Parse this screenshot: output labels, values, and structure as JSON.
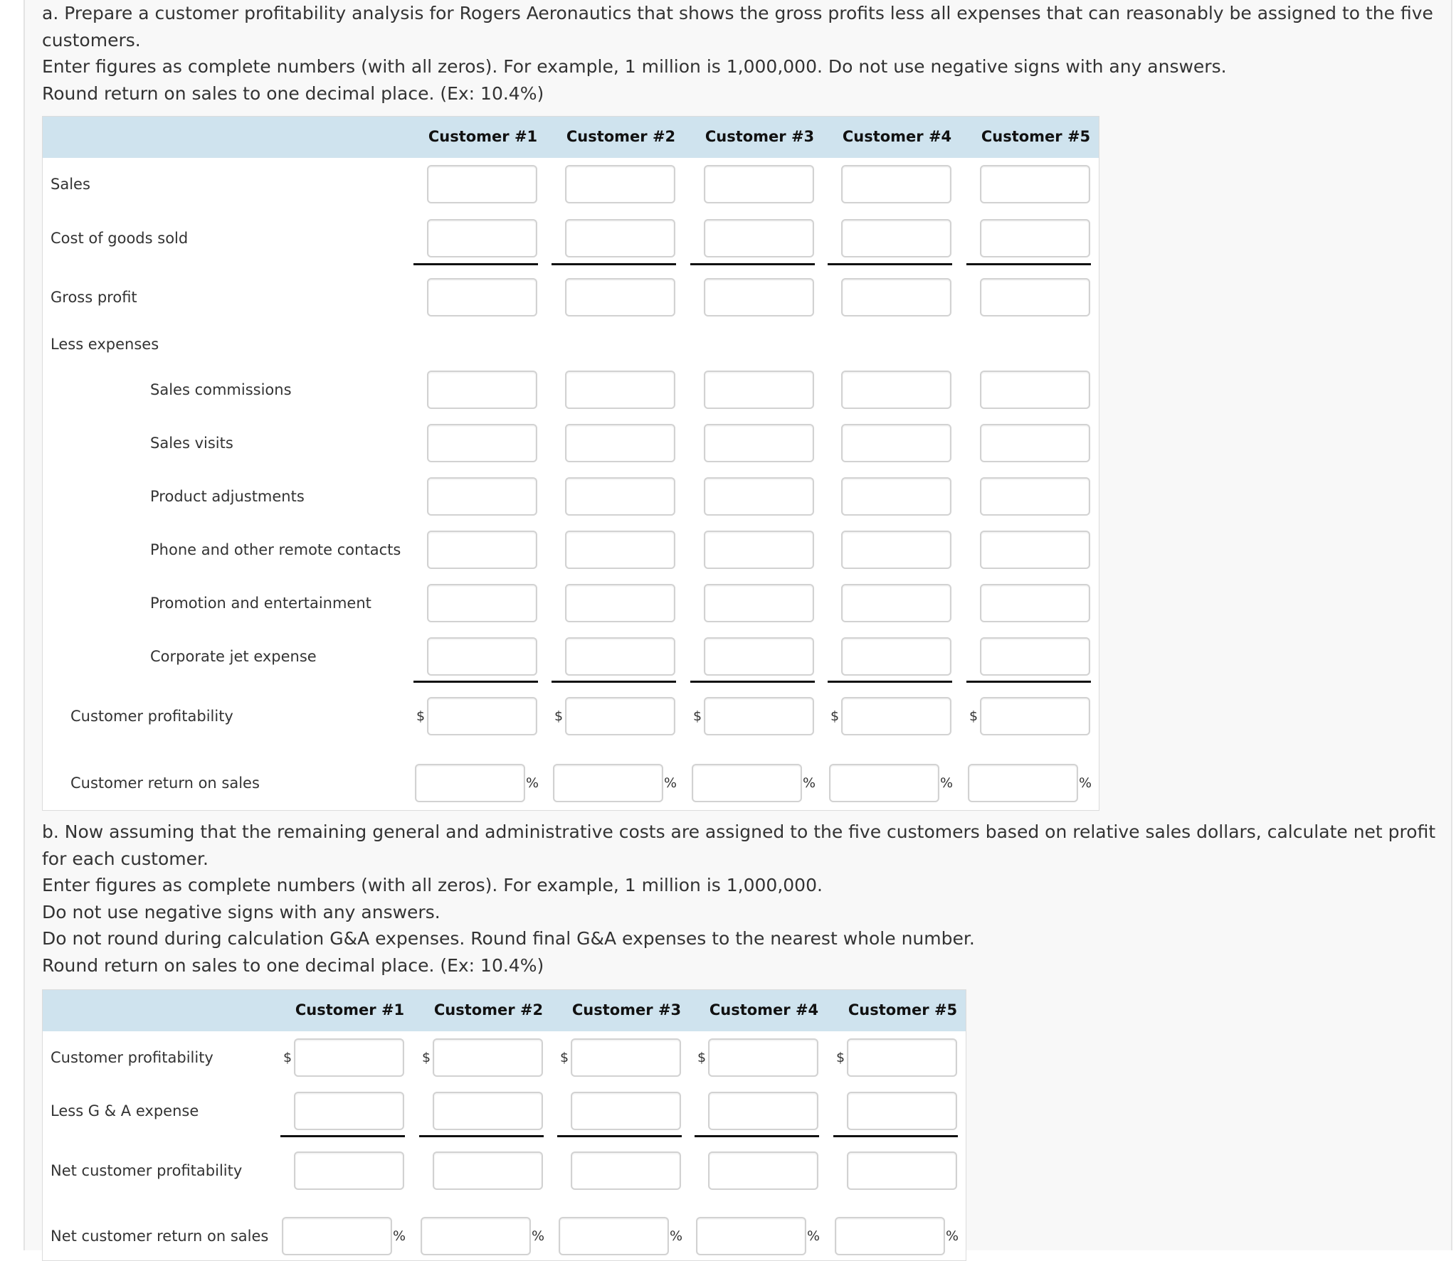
{
  "part_a": {
    "instructions": [
      "a. Prepare a customer profitability analysis for Rogers Aeronautics that shows the gross profits less all expenses that can reasonably be assigned to the five",
      "customers.",
      "Enter figures as complete numbers (with all zeros). For example, 1 million is 1,000,000. Do not use negative signs with any answers.",
      "Round return on sales to one decimal place. (Ex: 10.4%)"
    ],
    "columns": [
      "Customer #1",
      "Customer #2",
      "Customer #3",
      "Customer #4",
      "Customer #5"
    ],
    "rows": {
      "sales": "Sales",
      "cogs": "Cost of goods sold",
      "gross_profit": "Gross profit",
      "less_expenses": "Less expenses",
      "sales_commissions": "Sales commissions",
      "sales_visits": "Sales visits",
      "product_adjustments": "Product adjustments",
      "phone": "Phone and other remote contacts",
      "promotion": "Promotion and entertainment",
      "jet": "Corporate jet expense",
      "customer_profitability": "Customer profitability",
      "return_on_sales": "Customer return on sales"
    }
  },
  "part_b": {
    "instructions": [
      "b. Now assuming that the remaining general and administrative costs are assigned to the five customers based on relative sales dollars, calculate net profit",
      "for each customer.",
      "Enter figures as complete numbers (with all zeros). For example, 1 million is 1,000,000.",
      "Do not use negative signs with any answers.",
      "Do not round during calculation G&A expenses. Round final G&A expenses to the nearest whole number.",
      "Round return on sales to one decimal place. (Ex: 10.4%)"
    ],
    "columns": [
      "Customer #1",
      "Customer #2",
      "Customer #3",
      "Customer #4",
      "Customer #5"
    ],
    "rows": {
      "customer_profitability": "Customer profitability",
      "less_ga": "Less G & A expense",
      "net_profitability": "Net customer profitability",
      "net_return_on_sales": "Net customer return on sales"
    }
  },
  "symbols": {
    "dollar": "$",
    "percent": "%"
  },
  "inputs": {
    "value": ""
  }
}
